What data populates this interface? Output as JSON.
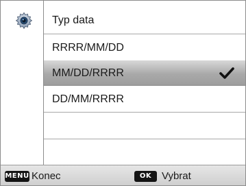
{
  "menu": {
    "title": "Typ data",
    "options": [
      {
        "label": "RRRR/MM/DD",
        "selected": false
      },
      {
        "label": "MM/DD/RRRR",
        "selected": true
      },
      {
        "label": "DD/MM/RRRR",
        "selected": false
      }
    ]
  },
  "footer": {
    "menu_key": "MENU",
    "exit_label": "Konec",
    "ok_key": "OK",
    "select_label": "Vybrat"
  },
  "icons": {
    "settings": "gear-icon",
    "selected_marker": "check-icon"
  },
  "colors": {
    "highlight": "#a9a9a9",
    "divider": "#a8a8a8",
    "footer_bg": "#dadada"
  }
}
